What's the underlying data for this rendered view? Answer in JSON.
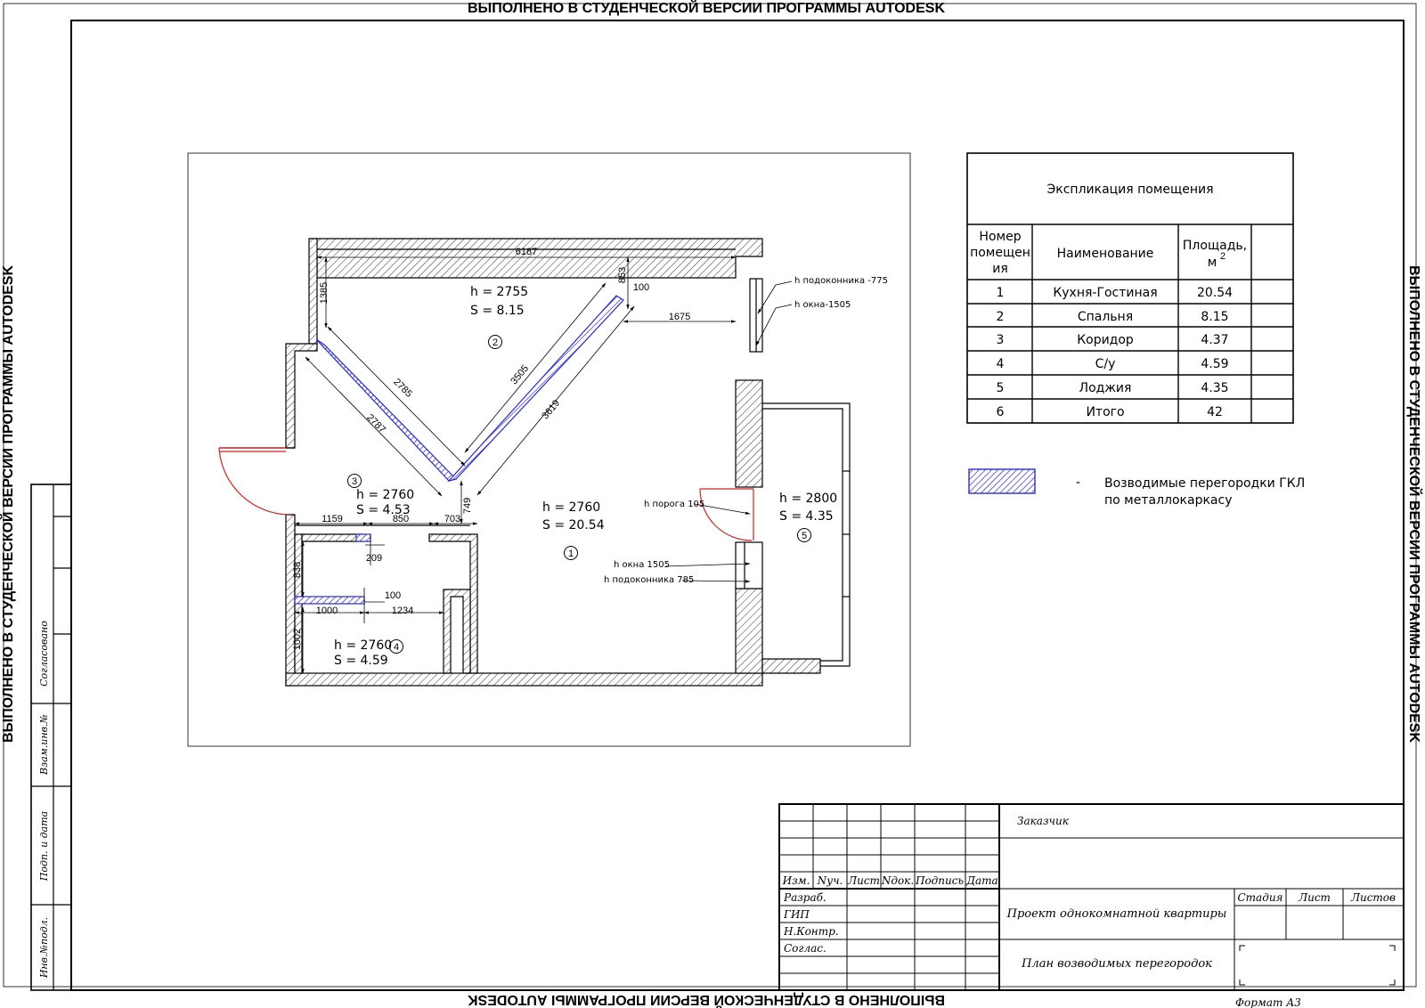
{
  "watermark": "ВЫПОЛНЕНО В СТУДЕНЧЕСКОЙ ВЕРСИИ ПРОГРАММЫ AUTODESK",
  "plan": {
    "dims": {
      "d6187": "6187",
      "d1385": "1385",
      "d853": "853",
      "d100a": "100",
      "d1675": "1675",
      "d2785": "2785",
      "d3505": "3505",
      "d2787": "2787",
      "d3619": "3619",
      "d749": "749",
      "d1159": "1159",
      "d850": "850",
      "d703": "703",
      "d209": "209",
      "d838": "838",
      "d100b": "100",
      "d1000": "1000",
      "d1234": "1234",
      "d1002": "1002"
    },
    "notes": {
      "sill_top": "h подоконника -775",
      "window_top": "h окна-1505",
      "threshold": "h порога 105",
      "window_mid": "h окна 1505",
      "sill_mid": "h подоконника 785"
    },
    "rooms": [
      {
        "num": "1",
        "h": "h = 2760",
        "s": "S = 20.54"
      },
      {
        "num": "2",
        "h": "h = 2755",
        "s": "S = 8.15"
      },
      {
        "num": "3",
        "h": "h = 2760",
        "s": "S = 4.53"
      },
      {
        "num": "4",
        "h": "h = 2760",
        "s": "S = 4.59"
      },
      {
        "num": "5",
        "h": "h = 2800",
        "s": "S = 4.35"
      }
    ]
  },
  "explication": {
    "title": "Экспликация помещения",
    "headers": {
      "num": [
        "Номер",
        "помещен",
        "ия"
      ],
      "name": "Наименование",
      "area": "Площадь,",
      "area_unit": "м",
      "area_sup": "2"
    },
    "rows": [
      {
        "num": "1",
        "name": "Кухня-Гостиная",
        "area": "20.54"
      },
      {
        "num": "2",
        "name": "Спальня",
        "area": "8.15"
      },
      {
        "num": "3",
        "name": "Коридор",
        "area": "4.37"
      },
      {
        "num": "4",
        "name": "С/у",
        "area": "4.59"
      },
      {
        "num": "5",
        "name": "Лоджия",
        "area": "4.35"
      },
      {
        "num": "6",
        "name": "Итого",
        "area": "42"
      }
    ]
  },
  "legend": {
    "dash": "-",
    "line1": "Возводимые перегородки ГКЛ",
    "line2": "по металлокаркасу"
  },
  "stamp": {
    "customer": "Заказчик",
    "headers": [
      "Изм.",
      "Nуч.",
      "Лист",
      "Nдок.",
      "Подпись",
      "Дата"
    ],
    "roles": [
      "Разраб.",
      "ГИП",
      "Н.Контр.",
      "Соглас."
    ],
    "project": "Проект однокомнатной квартиры",
    "sheet_title": "План возводимых перегородок",
    "stage": "Стадия",
    "sheet": "Лист",
    "sheets": "Листов",
    "format": "Формат А3"
  },
  "side_stamp": {
    "agreed": "Согласовано",
    "inv_replace": "Взам.инв.№",
    "sign_date": "Подп. и дата",
    "inv_orig": "Инв.№подл."
  },
  "colors": {
    "partition": "#2a2ad0",
    "door": "#d22222"
  }
}
